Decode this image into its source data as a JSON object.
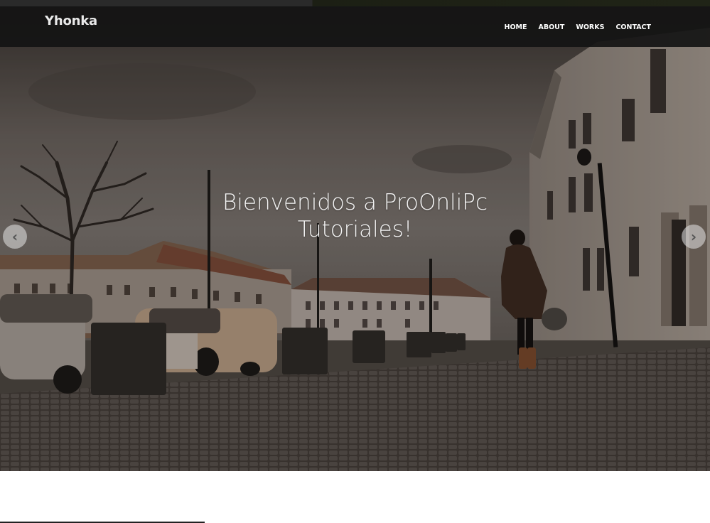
{
  "brand": {
    "name": "Yhonka"
  },
  "nav": {
    "items": [
      {
        "label": "HOME"
      },
      {
        "label": "ABOUT"
      },
      {
        "label": "WORKS"
      },
      {
        "label": "CONTACT"
      }
    ]
  },
  "hero": {
    "title": "Bienvenidos a ProOnliPc\nTutoriales!",
    "prev_icon": "chevron-left-icon",
    "next_icon": "chevron-right-icon",
    "prev_glyph": "‹",
    "next_glyph": "›"
  },
  "colors": {
    "navbar": "#141414",
    "nav_text": "#ffffff",
    "hero_text": "#f4f4f4"
  }
}
